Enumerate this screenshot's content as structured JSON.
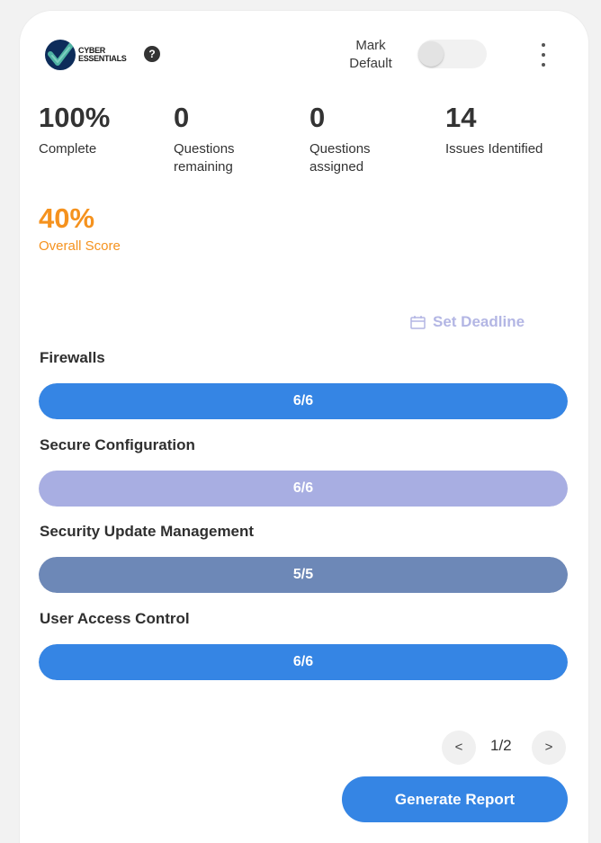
{
  "header": {
    "logo_line1": "CYBER",
    "logo_line2": "ESSENTIALS",
    "help_glyph": "?",
    "mark_default_line1": "Mark",
    "mark_default_line2": "Default",
    "mark_default_on": false
  },
  "stats": {
    "complete": {
      "value": "100%",
      "label": "Complete"
    },
    "questions_remaining": {
      "value": "0",
      "label": "Questions remaining"
    },
    "questions_assigned": {
      "value": "0",
      "label": "Questions assigned"
    },
    "issues_identified": {
      "value": "14",
      "label": "Issues Identified"
    },
    "overall_score": {
      "value": "40%",
      "label": "Overall Score"
    }
  },
  "deadline": {
    "label": "Set Deadline"
  },
  "categories": [
    {
      "title": "Firewalls",
      "progress": "6/6",
      "fraction": 1.0,
      "color": "#3585e4"
    },
    {
      "title": "Secure Configuration",
      "progress": "6/6",
      "fraction": 1.0,
      "color": "#a8aee2"
    },
    {
      "title": "Security Update Management",
      "progress": "5/5",
      "fraction": 1.0,
      "color": "#6d88b7"
    },
    {
      "title": "User Access Control",
      "progress": "6/6",
      "fraction": 1.0,
      "color": "#3585e4"
    }
  ],
  "pagination": {
    "prev": "<",
    "indicator": "1/2",
    "next": ">"
  },
  "actions": {
    "generate_report": "Generate Report"
  },
  "colors": {
    "accent": "#3585e4",
    "score": "#f5921e",
    "deadline": "#b3b6e4"
  }
}
